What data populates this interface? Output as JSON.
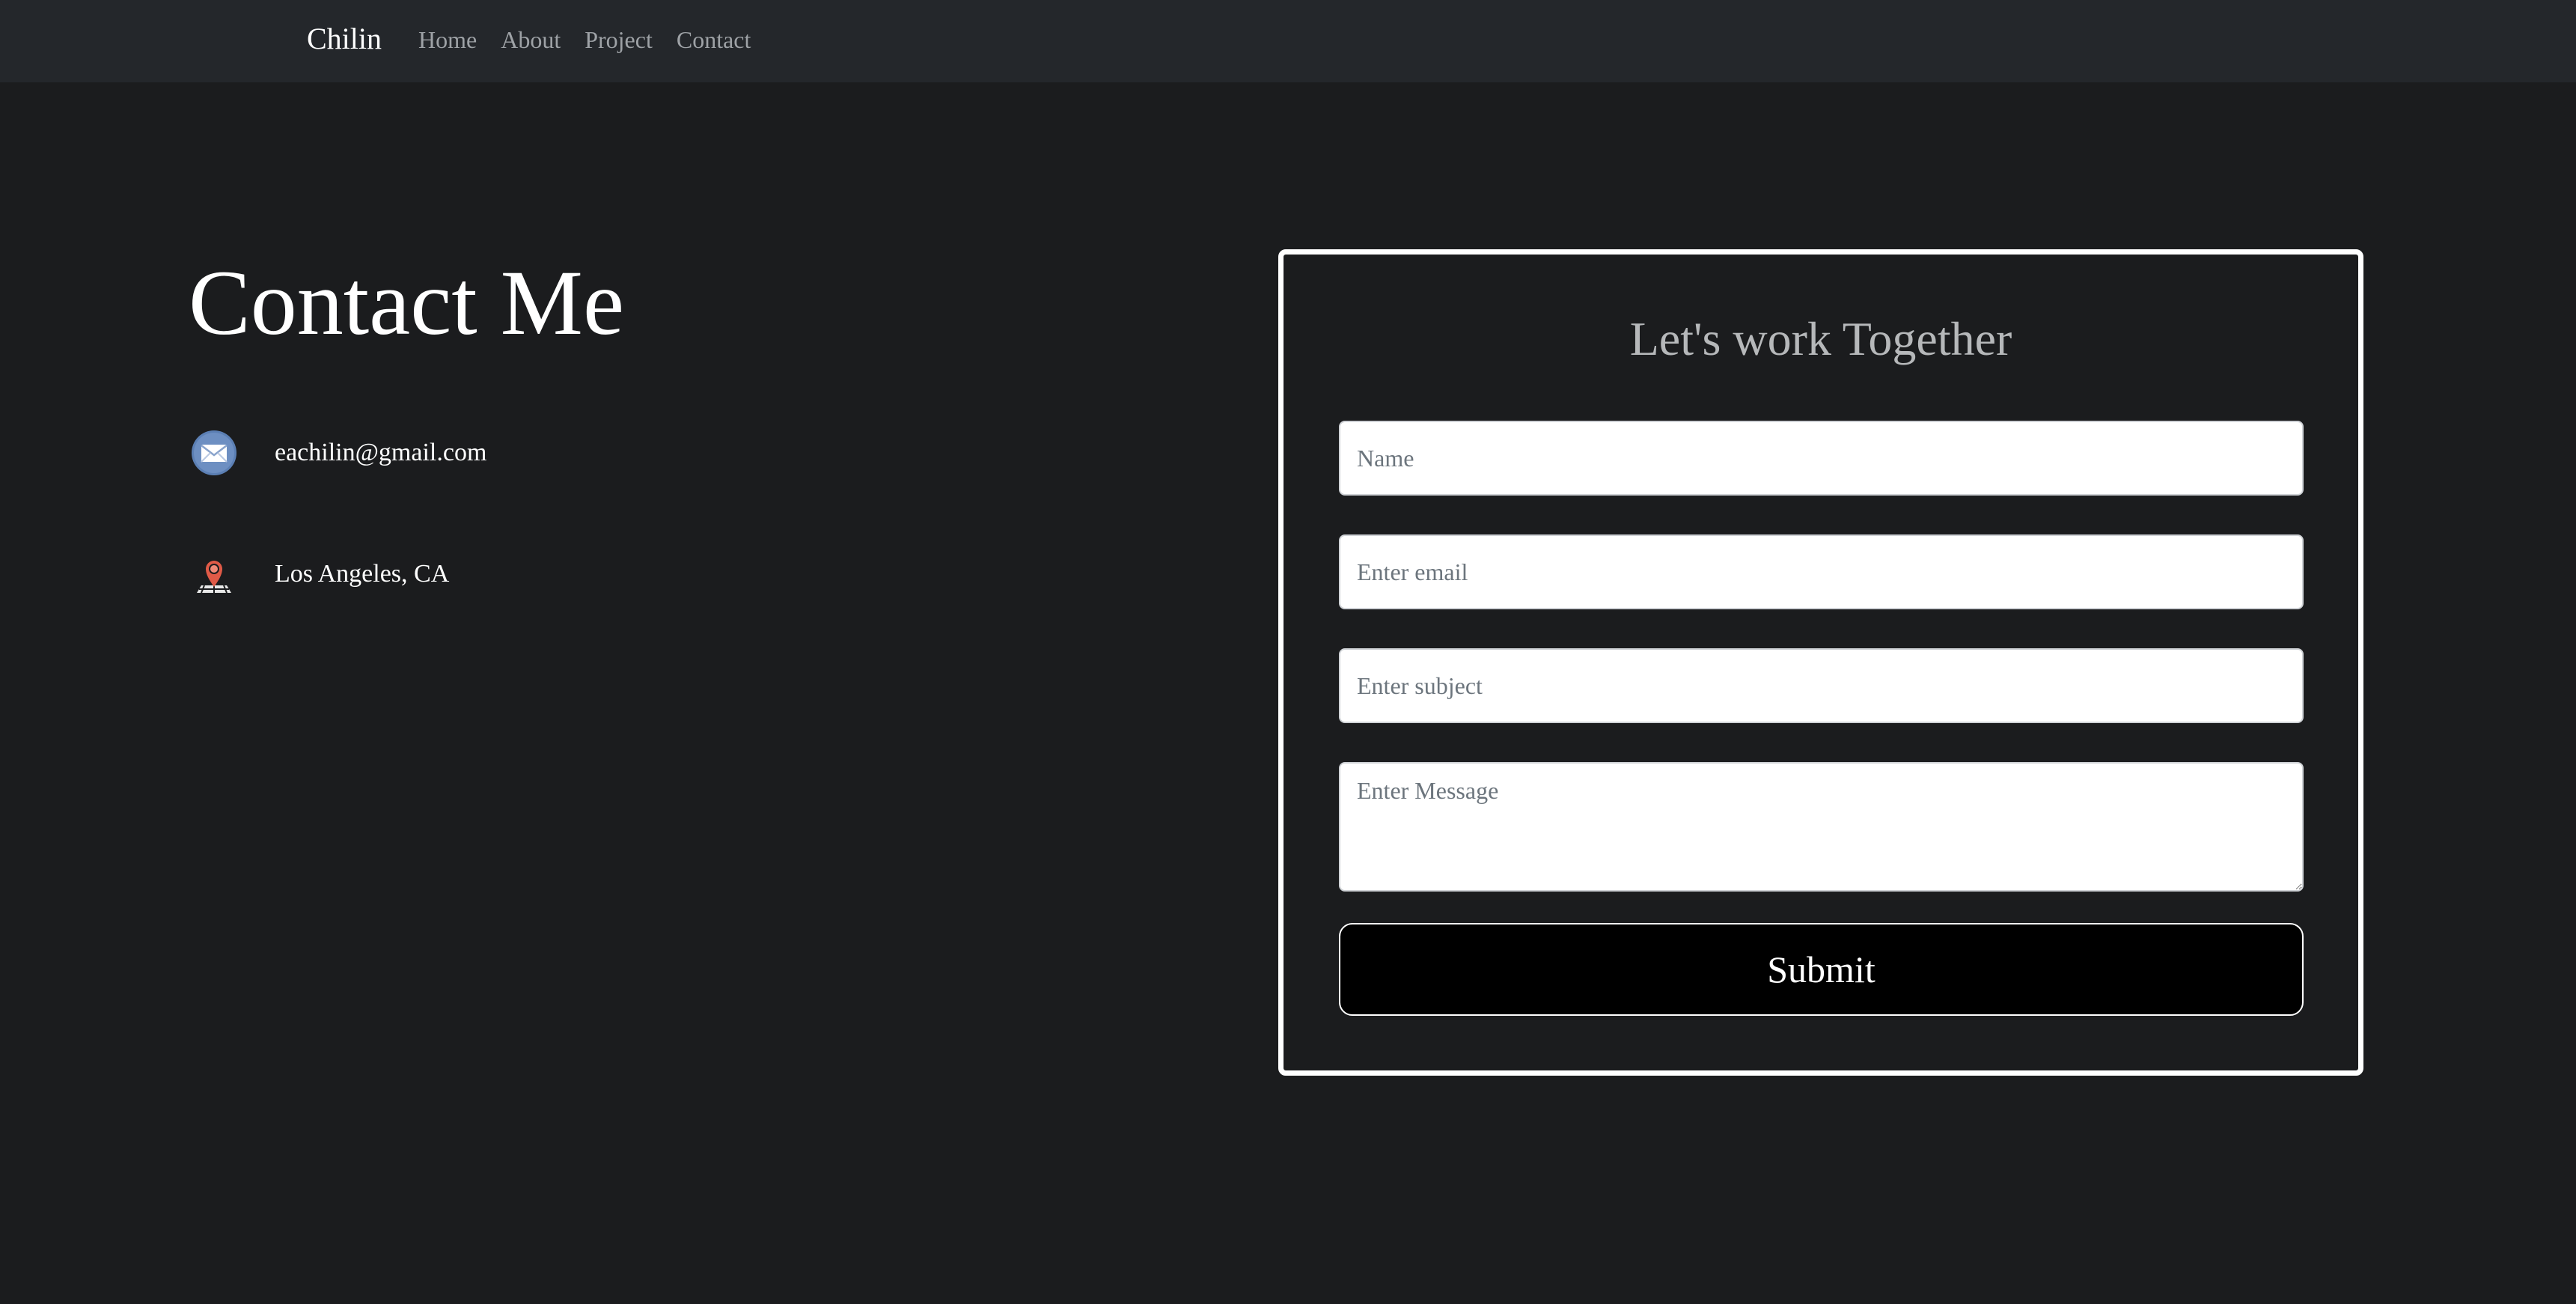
{
  "navbar": {
    "brand": "Chilin",
    "links": [
      "Home",
      "About",
      "Project",
      "Contact"
    ]
  },
  "main": {
    "title": "Contact Me",
    "contact_info": {
      "email": {
        "icon": "envelope-icon",
        "text": "eachilin@gmail.com"
      },
      "location": {
        "icon": "map-pin-icon",
        "text": "Los Angeles, CA"
      }
    }
  },
  "form": {
    "title": "Let's work Together",
    "name_placeholder": "Name",
    "email_placeholder": "Enter email",
    "subject_placeholder": "Enter subject",
    "message_placeholder": "Enter Message",
    "submit_label": "Submit"
  },
  "colors": {
    "background": "#1b1c1e",
    "navbar": "#24272b",
    "nav_link": "#9ea2a6",
    "form_title": "#b6b8ba",
    "submit_bg": "#000000",
    "email_icon": "#5b7fb4",
    "pin_icon": "#e05a47"
  }
}
